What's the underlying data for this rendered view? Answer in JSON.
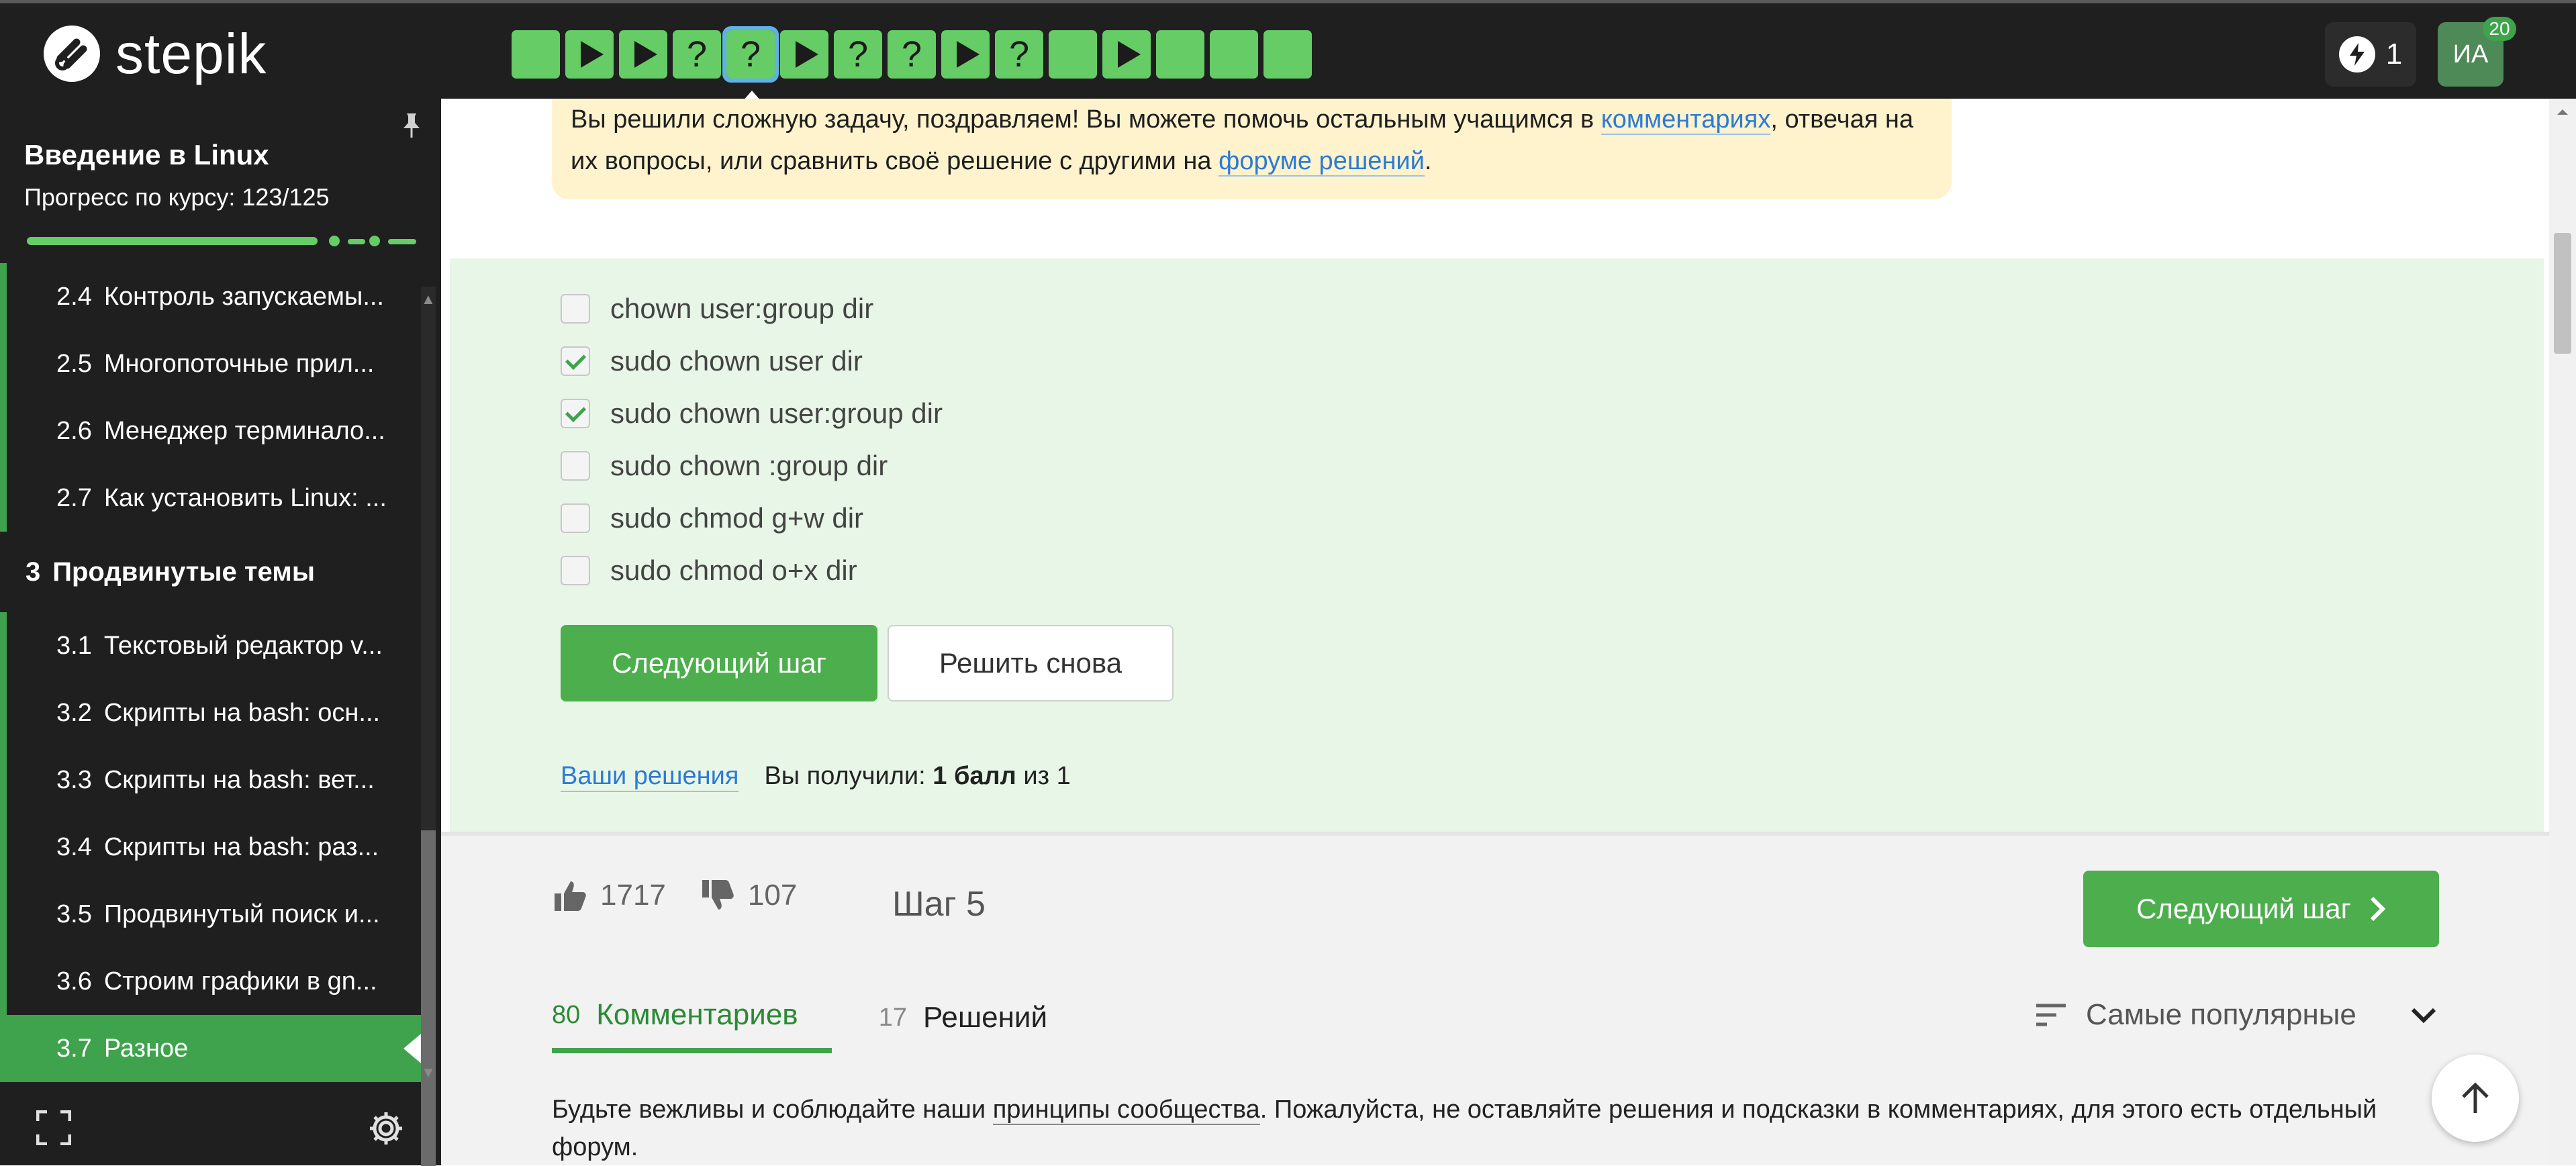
{
  "brand": {
    "name": "stepik",
    "logo_icon": "stepik-logo-icon"
  },
  "header": {
    "steps": [
      {
        "kind": "text"
      },
      {
        "kind": "play"
      },
      {
        "kind": "play"
      },
      {
        "kind": "quiz",
        "label": "?"
      },
      {
        "kind": "quiz",
        "label": "?",
        "active": true
      },
      {
        "kind": "play"
      },
      {
        "kind": "quiz",
        "label": "?"
      },
      {
        "kind": "quiz",
        "label": "?"
      },
      {
        "kind": "play"
      },
      {
        "kind": "quiz",
        "label": "?"
      },
      {
        "kind": "text"
      },
      {
        "kind": "play"
      },
      {
        "kind": "text"
      },
      {
        "kind": "text"
      },
      {
        "kind": "text"
      }
    ],
    "energy_count": "1",
    "avatar_initials": "ИА",
    "avatar_badge": "20"
  },
  "sidebar": {
    "course_title": "Введение в Linux",
    "progress_label": "Прогресс по курсу:  123/125",
    "progress_fraction": 0.984,
    "items": [
      {
        "num": "2.4",
        "label": "Контроль запускаемы..."
      },
      {
        "num": "2.5",
        "label": "Многопоточные прил..."
      },
      {
        "num": "2.6",
        "label": "Менеджер терминало..."
      },
      {
        "num": "2.7",
        "label": "Как установить Linux: ..."
      }
    ],
    "section": {
      "num": "3",
      "label": "Продвинутые темы"
    },
    "sub_items": [
      {
        "num": "3.1",
        "label": "Текстовый редактор v..."
      },
      {
        "num": "3.2",
        "label": "Скрипты на bash: осн..."
      },
      {
        "num": "3.3",
        "label": "Скрипты на bash: вет..."
      },
      {
        "num": "3.4",
        "label": "Скрипты на bash: раз..."
      },
      {
        "num": "3.5",
        "label": "Продвинутый поиск и..."
      },
      {
        "num": "3.6",
        "label": "Строим графики в gn..."
      },
      {
        "num": "3.7",
        "label": "Разное"
      }
    ]
  },
  "congrats": {
    "text_1": "Вы решили сложную задачу, поздравляем! Вы можете помочь остальным учащимся в ",
    "link_comments": "комментариях",
    "text_2": ", отвечая на их вопросы, или сравнить своё решение с другими на ",
    "link_forum": "форуме решений",
    "text_3": "."
  },
  "quiz": {
    "options": [
      {
        "label": "chown user:group dir",
        "checked": false
      },
      {
        "label": "sudo chown user dir",
        "checked": true
      },
      {
        "label": "sudo chown user:group dir",
        "checked": true
      },
      {
        "label": "sudo chown :group dir",
        "checked": false
      },
      {
        "label": "sudo chmod g+w dir",
        "checked": false
      },
      {
        "label": "sudo chmod o+x dir",
        "checked": false
      }
    ],
    "next_button": "Следующий шаг",
    "retry_button": "Решить снова",
    "solutions_link": "Ваши решения",
    "score_prefix": "Вы получили: ",
    "score_value": "1 балл",
    "score_suffix": " из 1"
  },
  "footer": {
    "likes": "1717",
    "dislikes": "107",
    "step_label": "Шаг 5",
    "next_button": "Следующий шаг",
    "tabs": [
      {
        "count": "80",
        "label": "Комментариев",
        "active": true
      },
      {
        "count": "17",
        "label": "Решений",
        "active": false
      }
    ],
    "sort_label": "Самые популярные",
    "notice_1": "Будьте вежливы и соблюдайте наши ",
    "notice_link": "принципы сообщества",
    "notice_2": ". Пожалуйста, не оставляйте решения и подсказки в комментариях, для этого есть отдельный форум."
  },
  "colors": {
    "accent": "#66cc66",
    "brand_green": "#4cae4c",
    "dark": "#1f1f1f",
    "link": "#2b7bd6",
    "notice_bg": "#fff3cd",
    "panel_bg": "#e8f6e8"
  }
}
